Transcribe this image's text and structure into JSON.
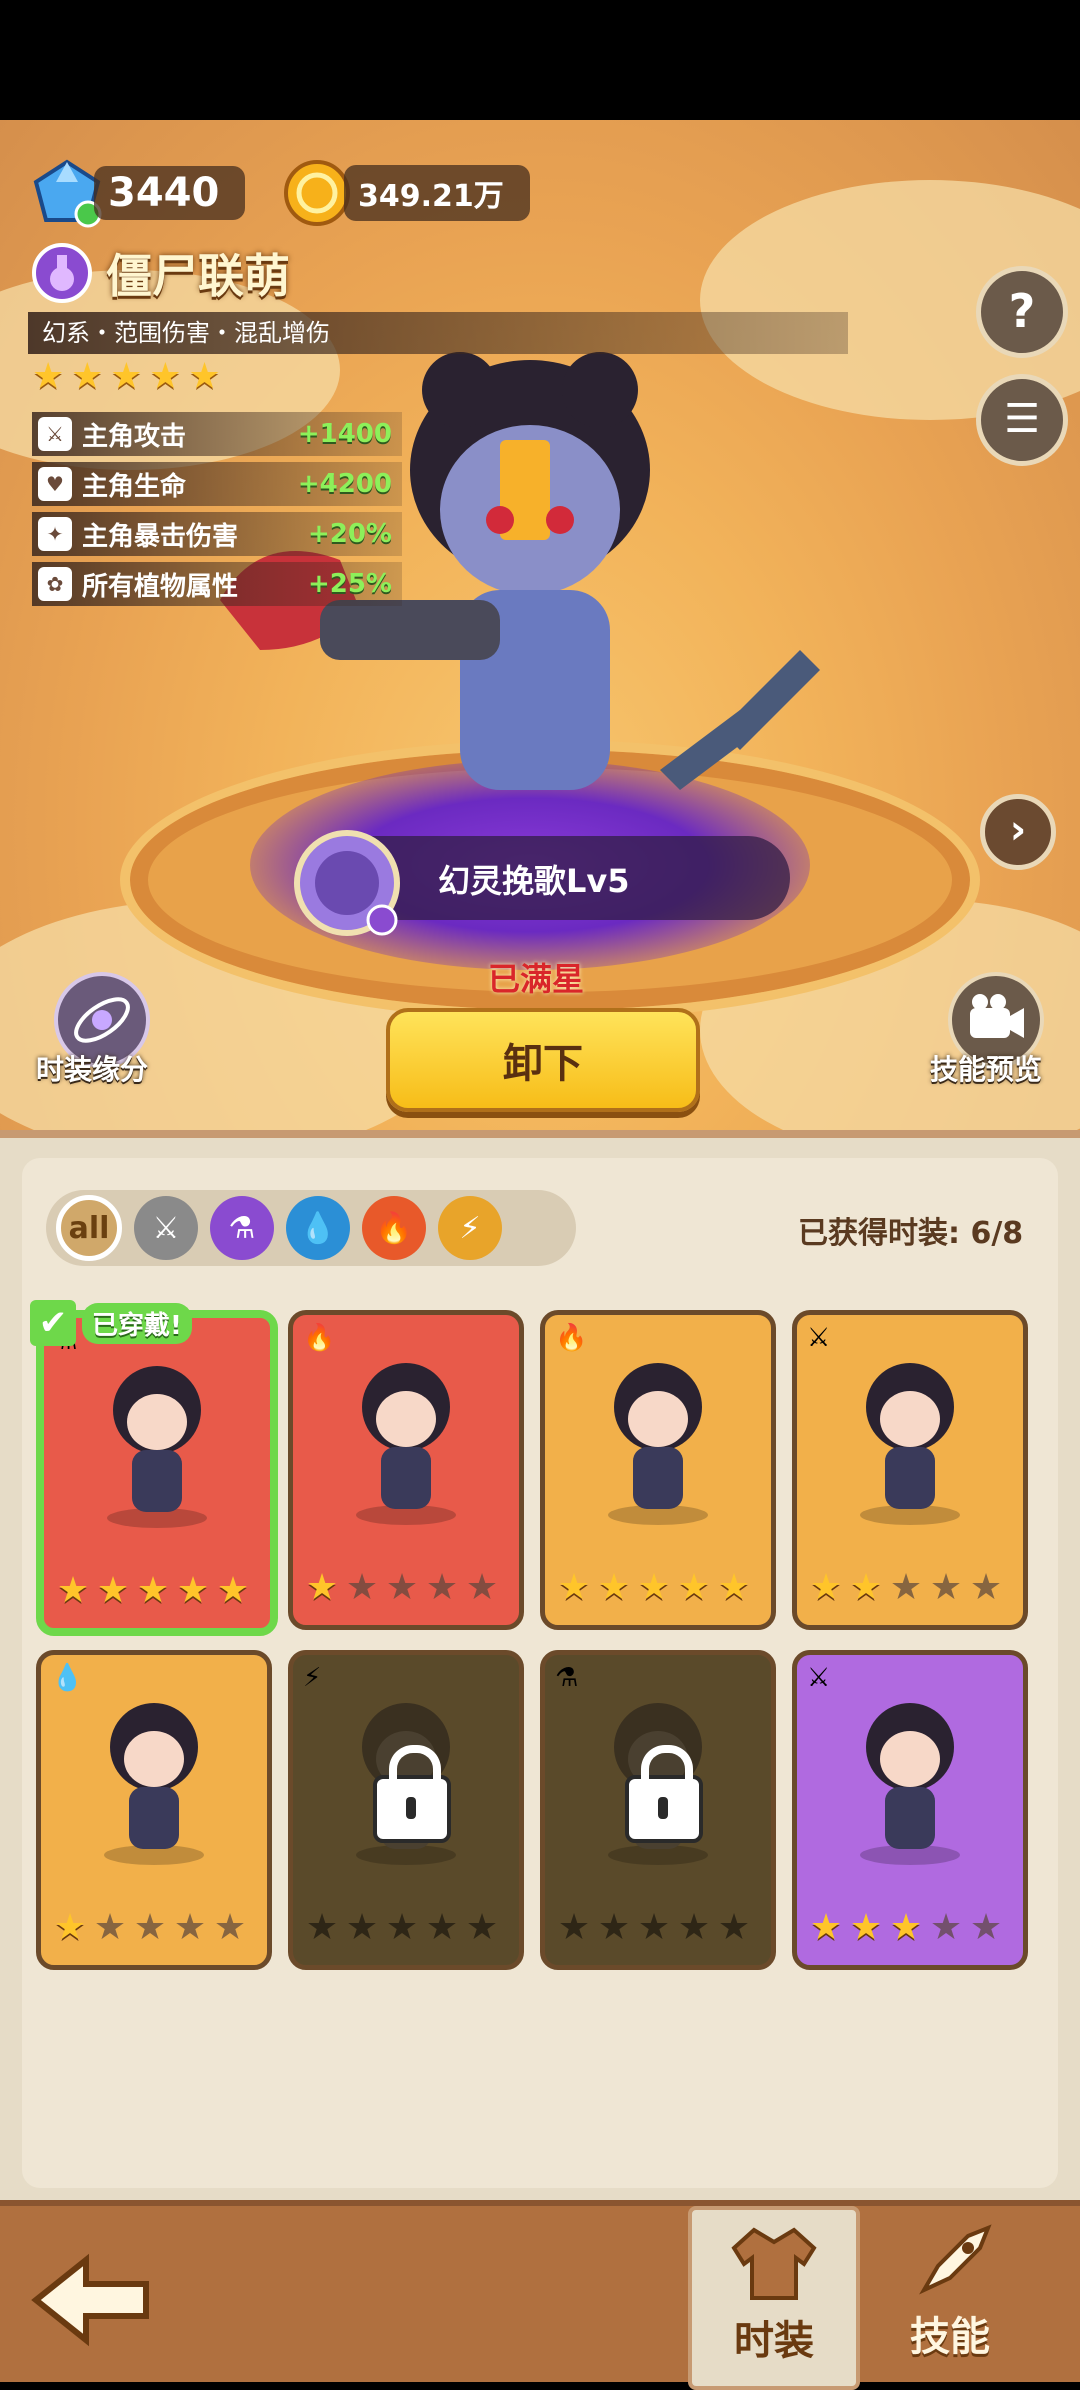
{
  "currency": {
    "gems": "3440",
    "coins": "349.21万"
  },
  "hero": {
    "name": "僵尸联萌",
    "tags": "幻系・范围伤害・混乱增伤",
    "stars": 5,
    "stats": [
      {
        "icon": "sword-icon",
        "label": "主角攻击",
        "value": "+1400"
      },
      {
        "icon": "heart-icon",
        "label": "主角生命",
        "value": "+4200"
      },
      {
        "icon": "crit-icon",
        "label": "主角暴击伤害",
        "value": "+20%"
      },
      {
        "icon": "plant-icon",
        "label": "所有植物属性",
        "value": "+25%"
      }
    ],
    "skill_name": "幻灵挽歌Lv5",
    "max_star_text": "已满星",
    "unequip_label": "卸下",
    "fashion_bond_label": "时装缘分",
    "skill_preview_label": "技能预览"
  },
  "panel": {
    "collected_text": "已获得时装: 6/8",
    "filters": [
      {
        "name": "all",
        "label": "all",
        "color": "#d0a86a"
      },
      {
        "name": "sword",
        "label": "",
        "color": "#8a8a8a"
      },
      {
        "name": "potion",
        "label": "",
        "color": "#8a4bd0"
      },
      {
        "name": "water",
        "label": "",
        "color": "#2b8fd6"
      },
      {
        "name": "fire",
        "label": "",
        "color": "#e8592a"
      },
      {
        "name": "lightning",
        "label": "",
        "color": "#e8a42a"
      }
    ],
    "worn_label": "已穿戴!",
    "cards": [
      {
        "bg": "#e85a4a",
        "element": "potion",
        "stars": 5,
        "locked": false,
        "worn": true
      },
      {
        "bg": "#e85a4a",
        "element": "fire",
        "stars": 1,
        "locked": false,
        "worn": false
      },
      {
        "bg": "#f2b04a",
        "element": "fire",
        "stars": 5,
        "locked": false,
        "worn": false
      },
      {
        "bg": "#f2b04a",
        "element": "sword",
        "stars": 2,
        "locked": false,
        "worn": false
      },
      {
        "bg": "#f2b04a",
        "element": "water",
        "stars": 1,
        "locked": false,
        "worn": false
      },
      {
        "bg": "#5a4a2a",
        "element": "lightning",
        "stars": 0,
        "locked": true,
        "worn": false
      },
      {
        "bg": "#5a4a2a",
        "element": "potion",
        "stars": 0,
        "locked": true,
        "worn": false
      },
      {
        "bg": "#b06ae0",
        "element": "sword",
        "stars": 3,
        "locked": false,
        "worn": false
      }
    ]
  },
  "bottom_tabs": {
    "fashion": "时装",
    "skill": "技能"
  },
  "colors": {
    "accent_yellow": "#ffd23a",
    "stat_green": "#8df05a",
    "worn_green": "#6ed84a"
  }
}
